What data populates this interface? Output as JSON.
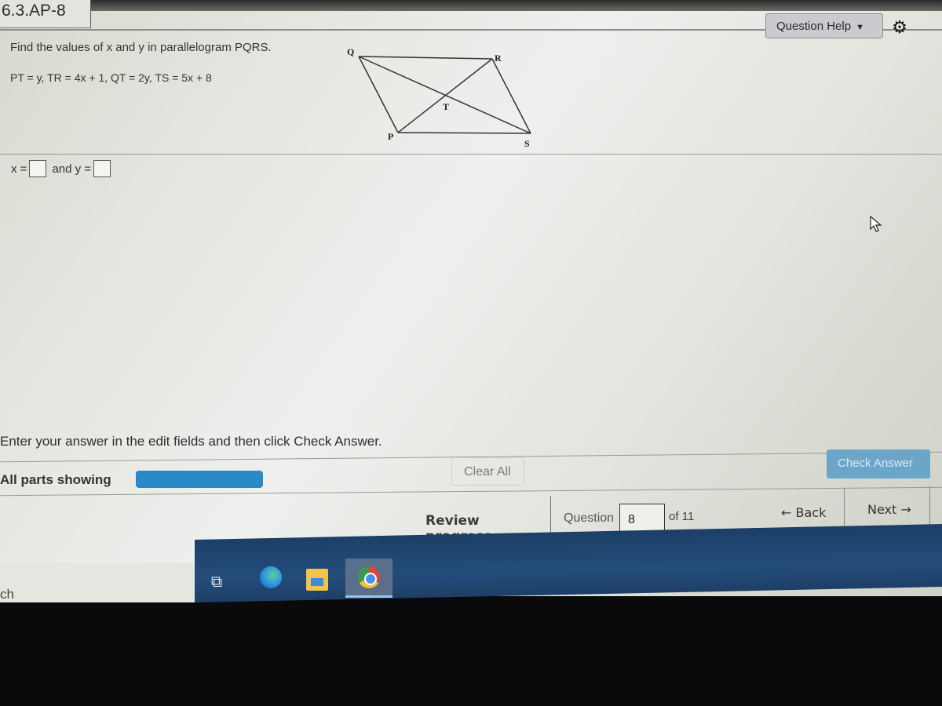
{
  "header": {
    "title": "6.3.AP-8",
    "question_help_label": "Question Help",
    "question_help_arrow": "▼",
    "settings_icon": "gear-icon"
  },
  "question": {
    "prompt": "Find the values of x and y in parallelogram PQRS.",
    "given": "PT = y, TR = 4x + 1, QT = 2y, TS = 5x + 8",
    "diagram": {
      "vertices": [
        "Q",
        "R",
        "P",
        "S"
      ],
      "intersection": "T"
    },
    "answer": {
      "x_label": "x =",
      "x_value": "",
      "joiner": "and y =",
      "y_value": ""
    }
  },
  "footer": {
    "instruction": "Enter your answer in the edit fields and then click Check Answer.",
    "parts_label": "All parts showing",
    "clear_all_label": "Clear All",
    "check_answer_label": "Check Answer",
    "review_progress_label": "Review progress",
    "question_label": "Question",
    "question_number": "8",
    "question_total": "of 11",
    "back_label": "← Back",
    "next_label": "Next →"
  },
  "taskbar": {
    "search_fragment": "ch",
    "apps": [
      "task-view",
      "edge",
      "file-explorer",
      "chrome"
    ],
    "active_app": "chrome"
  },
  "colors": {
    "progress_fill": "#2a88c8",
    "check_button": "#6ba6c8",
    "taskbar": "#244d7c"
  }
}
